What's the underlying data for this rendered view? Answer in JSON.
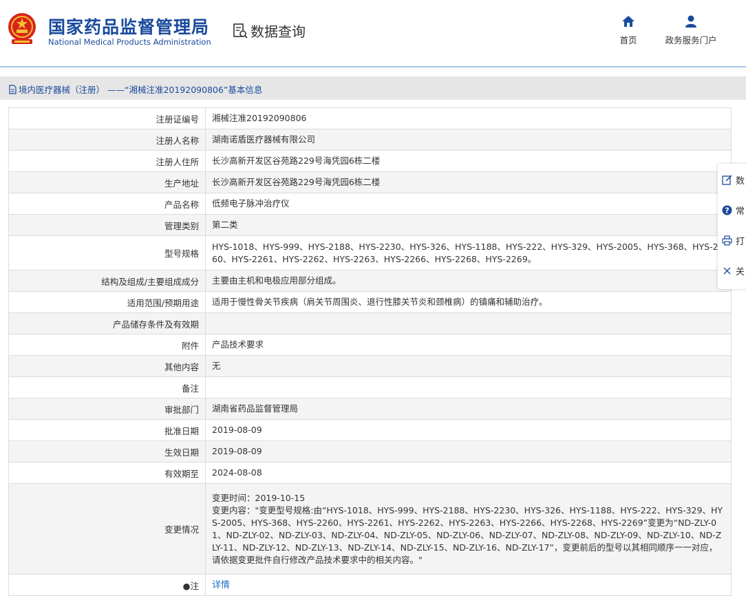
{
  "header": {
    "brand_cn": "国家药品监督管理局",
    "brand_en": "National Medical Products Administration",
    "data_query": "数据查询",
    "nav": [
      {
        "label": "首页",
        "icon": "home-icon"
      },
      {
        "label": "政务服务门户",
        "icon": "user-icon"
      }
    ]
  },
  "breadcrumb": "境内医疗器械（注册） ——“湘械注准20192090806”基本信息",
  "rows": [
    {
      "key": "注册证编号",
      "value": "湘械注准20192090806"
    },
    {
      "key": "注册人名称",
      "value": "湖南诺盾医疗器械有限公司"
    },
    {
      "key": "注册人住所",
      "value": "长沙高新开发区谷苑路229号海凭园6栋二楼"
    },
    {
      "key": "生产地址",
      "value": "长沙高新开发区谷苑路229号海凭园6栋二楼"
    },
    {
      "key": "产品名称",
      "value": "低频电子脉冲治疗仪"
    },
    {
      "key": "管理类别",
      "value": "第二类"
    },
    {
      "key": "型号规格",
      "value": "HYS-1018、HYS-999、HYS-2188、HYS-2230、HYS-326、HYS-1188、HYS-222、HYS-329、HYS-2005、HYS-368、HYS-2260、HYS-2261、HYS-2262、HYS-2263、HYS-2266、HYS-2268、HYS-2269。"
    },
    {
      "key": "结构及组成/主要组成成分",
      "value": "主要由主机和电极应用部分组成。"
    },
    {
      "key": "适用范围/预期用途",
      "value": "适用于慢性骨关节疾病（肩关节周围炎、退行性膝关节炎和颈椎病）的镇痛和辅助治疗。"
    },
    {
      "key": "产品储存条件及有效期",
      "value": ""
    },
    {
      "key": "附件",
      "value": "产品技术要求"
    },
    {
      "key": "其他内容",
      "value": "无"
    },
    {
      "key": "备注",
      "value": ""
    },
    {
      "key": "审批部门",
      "value": "湖南省药品监督管理局"
    },
    {
      "key": "批准日期",
      "value": "2019-08-09"
    },
    {
      "key": "生效日期",
      "value": "2019-08-09"
    },
    {
      "key": "有效期至",
      "value": "2024-08-08"
    }
  ],
  "change": {
    "key": "变更情况",
    "time": "变更时间：2019-10-15",
    "content": "变更内容：\"变更型号规格:由“HYS-1018、HYS-999、HYS-2188、HYS-2230、HYS-326、HYS-1188、HYS-222、HYS-329、HYS-2005、HYS-368、HYS-2260、HYS-2261、HYS-2262、HYS-2263、HYS-2266、HYS-2268、HYS-2269”变更为“ND-ZLY-01、ND-ZLY-02、ND-ZLY-03、ND-ZLY-04、ND-ZLY-05、ND-ZLY-06、ND-ZLY-07、ND-ZLY-08、ND-ZLY-09、ND-ZLY-10、ND-ZLY-11、ND-ZLY-12、ND-ZLY-13、ND-ZLY-14、ND-ZLY-15、ND-ZLY-16、ND-ZLY-17”，变更前后的型号以其相同顺序一一对应，请依据变更批件自行修改产品技术要求中的相关内容。\""
  },
  "note": {
    "key": "●注",
    "link": "详情"
  },
  "sidetools": [
    {
      "label": "数",
      "icon": "edit-icon"
    },
    {
      "label": "常",
      "icon": "help-icon"
    },
    {
      "label": "打",
      "icon": "print-icon"
    },
    {
      "label": "关",
      "icon": "close-icon"
    }
  ],
  "colors": {
    "brand": "#1a4a9c",
    "link": "#1a6fc4",
    "rule": "#a7c3e5"
  }
}
